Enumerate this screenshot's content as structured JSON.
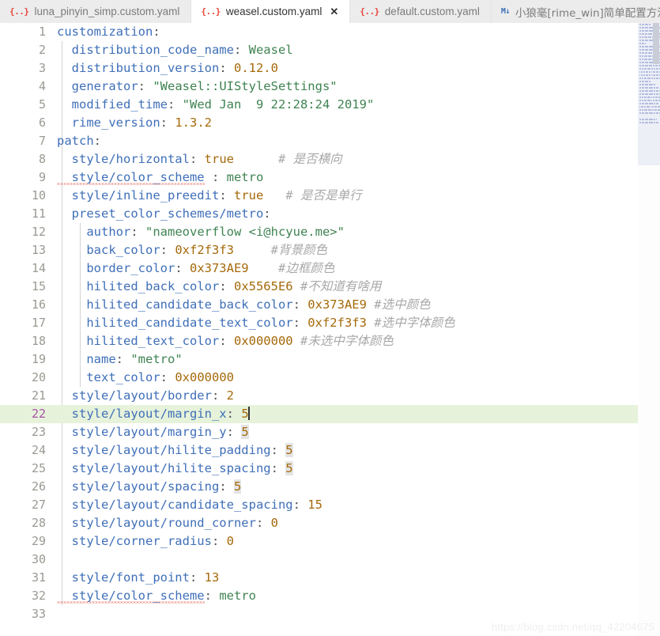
{
  "window": {
    "app": "Visual Studio Code",
    "active_file": "weasel.custom.yaml"
  },
  "tabs": [
    {
      "label": "luna_pinyin_simp.custom.yaml",
      "icon": "yaml-file-icon",
      "icon_glyph": "{..}",
      "active": false,
      "closable": false,
      "cjk": false
    },
    {
      "label": "weasel.custom.yaml",
      "icon": "yaml-file-icon",
      "icon_glyph": "{..}",
      "active": true,
      "closable": true,
      "close_glyph": "✕",
      "cjk": false
    },
    {
      "label": "default.custom.yaml",
      "icon": "yaml-file-icon",
      "icon_glyph": "{..}",
      "active": false,
      "closable": false,
      "cjk": false
    },
    {
      "label": "小狼毫[rime_win]简单配置方法.md",
      "icon": "markdown-file-icon",
      "icon_glyph": "M↓",
      "active": false,
      "closable": false,
      "cjk": true
    }
  ],
  "editor": {
    "cursor_line": 22,
    "total_visible_lines": 33,
    "colors": {
      "key": "#3f6fb8",
      "string": "#3f8352",
      "number": "#a5690a",
      "comment": "#a8a8a8",
      "current_line_bg": "#e6f2da",
      "current_line_number": "#a854a8",
      "line_number": "#9a9a93",
      "background": "#ffffff"
    },
    "lines": [
      {
        "n": 1,
        "indent": 0,
        "tokens": [
          {
            "t": "k",
            "v": "customization"
          },
          {
            "t": "p",
            "v": ":"
          }
        ]
      },
      {
        "n": 2,
        "indent": 1,
        "tokens": [
          {
            "t": "k",
            "v": "  distribution_code_name"
          },
          {
            "t": "p",
            "v": ": "
          },
          {
            "t": "s",
            "v": "Weasel"
          }
        ]
      },
      {
        "n": 3,
        "indent": 1,
        "tokens": [
          {
            "t": "k",
            "v": "  distribution_version"
          },
          {
            "t": "p",
            "v": ": "
          },
          {
            "t": "n",
            "v": "0.12.0"
          }
        ]
      },
      {
        "n": 4,
        "indent": 1,
        "tokens": [
          {
            "t": "k",
            "v": "  generator"
          },
          {
            "t": "p",
            "v": ": "
          },
          {
            "t": "s",
            "v": "\"Weasel::UIStyleSettings\""
          }
        ]
      },
      {
        "n": 5,
        "indent": 1,
        "tokens": [
          {
            "t": "k",
            "v": "  modified_time"
          },
          {
            "t": "p",
            "v": ": "
          },
          {
            "t": "s",
            "v": "\"Wed Jan  9 22:28:24 2019\""
          }
        ]
      },
      {
        "n": 6,
        "indent": 1,
        "tokens": [
          {
            "t": "k",
            "v": "  rime_version"
          },
          {
            "t": "p",
            "v": ": "
          },
          {
            "t": "n",
            "v": "1.3.2"
          }
        ]
      },
      {
        "n": 7,
        "indent": 0,
        "tokens": [
          {
            "t": "k",
            "v": "patch"
          },
          {
            "t": "p",
            "v": ":"
          }
        ]
      },
      {
        "n": 8,
        "indent": 1,
        "tokens": [
          {
            "t": "k",
            "v": "  style/horizontal"
          },
          {
            "t": "p",
            "v": ": "
          },
          {
            "t": "n",
            "v": "true"
          },
          {
            "t": "c",
            "v": "      # "
          },
          {
            "t": "c-cjk",
            "v": "是否横向"
          }
        ]
      },
      {
        "n": 9,
        "indent": 1,
        "tokens": [
          {
            "t": "k squig",
            "v": "  style/color_scheme"
          },
          {
            "t": "p",
            "v": " : "
          },
          {
            "t": "s",
            "v": "metro"
          }
        ]
      },
      {
        "n": 10,
        "indent": 1,
        "tokens": [
          {
            "t": "k",
            "v": "  style/inline_preedit"
          },
          {
            "t": "p",
            "v": ": "
          },
          {
            "t": "n",
            "v": "true"
          },
          {
            "t": "c",
            "v": "   # "
          },
          {
            "t": "c-cjk",
            "v": "是否是单行"
          }
        ]
      },
      {
        "n": 11,
        "indent": 1,
        "tokens": [
          {
            "t": "k",
            "v": "  preset_color_schemes/metro"
          },
          {
            "t": "p",
            "v": ":"
          }
        ]
      },
      {
        "n": 12,
        "indent": 2,
        "tokens": [
          {
            "t": "k",
            "v": "    author"
          },
          {
            "t": "p",
            "v": ": "
          },
          {
            "t": "s",
            "v": "\"nameoverflow <i@hcyue.me>\""
          }
        ]
      },
      {
        "n": 13,
        "indent": 2,
        "tokens": [
          {
            "t": "k",
            "v": "    back_color"
          },
          {
            "t": "p",
            "v": ": "
          },
          {
            "t": "n",
            "v": "0xf2f3f3"
          },
          {
            "t": "c",
            "v": "     #"
          },
          {
            "t": "c-cjk",
            "v": "背景颜色"
          }
        ]
      },
      {
        "n": 14,
        "indent": 2,
        "tokens": [
          {
            "t": "k",
            "v": "    border_color"
          },
          {
            "t": "p",
            "v": ": "
          },
          {
            "t": "n",
            "v": "0x373AE9"
          },
          {
            "t": "c",
            "v": "    #"
          },
          {
            "t": "c-cjk",
            "v": "边框颜色"
          }
        ]
      },
      {
        "n": 15,
        "indent": 2,
        "tokens": [
          {
            "t": "k",
            "v": "    hilited_back_color"
          },
          {
            "t": "p",
            "v": ": "
          },
          {
            "t": "n",
            "v": "0x5565E6"
          },
          {
            "t": "c",
            "v": " #"
          },
          {
            "t": "c-cjk",
            "v": "不知道有啥用"
          }
        ]
      },
      {
        "n": 16,
        "indent": 2,
        "tokens": [
          {
            "t": "k",
            "v": "    hilited_candidate_back_color"
          },
          {
            "t": "p",
            "v": ": "
          },
          {
            "t": "n",
            "v": "0x373AE9"
          },
          {
            "t": "c",
            "v": " #"
          },
          {
            "t": "c-cjk",
            "v": "选中颜色"
          }
        ]
      },
      {
        "n": 17,
        "indent": 2,
        "tokens": [
          {
            "t": "k",
            "v": "    hilited_candidate_text_color"
          },
          {
            "t": "p",
            "v": ": "
          },
          {
            "t": "n",
            "v": "0xf2f3f3"
          },
          {
            "t": "c",
            "v": " #"
          },
          {
            "t": "c-cjk",
            "v": "选中字体颜色"
          }
        ]
      },
      {
        "n": 18,
        "indent": 2,
        "tokens": [
          {
            "t": "k",
            "v": "    hilited_text_color"
          },
          {
            "t": "p",
            "v": ": "
          },
          {
            "t": "n",
            "v": "0x000000"
          },
          {
            "t": "c",
            "v": " #"
          },
          {
            "t": "c-cjk",
            "v": "未选中字体颜色"
          }
        ]
      },
      {
        "n": 19,
        "indent": 2,
        "tokens": [
          {
            "t": "k",
            "v": "    name"
          },
          {
            "t": "p",
            "v": ": "
          },
          {
            "t": "s",
            "v": "\"metro\""
          }
        ]
      },
      {
        "n": 20,
        "indent": 2,
        "tokens": [
          {
            "t": "k",
            "v": "    text_color"
          },
          {
            "t": "p",
            "v": ": "
          },
          {
            "t": "n",
            "v": "0x000000"
          }
        ]
      },
      {
        "n": 21,
        "indent": 1,
        "tokens": [
          {
            "t": "k",
            "v": "  style/layout/border"
          },
          {
            "t": "p",
            "v": ": "
          },
          {
            "t": "n",
            "v": "2"
          }
        ]
      },
      {
        "n": 22,
        "indent": 1,
        "current": true,
        "tokens": [
          {
            "t": "k",
            "v": "  style/layout/margin_x"
          },
          {
            "t": "p",
            "v": ": "
          },
          {
            "t": "n",
            "v": "5"
          },
          {
            "t": "caret",
            "v": ""
          }
        ]
      },
      {
        "n": 23,
        "indent": 1,
        "tokens": [
          {
            "t": "k",
            "v": "  style/layout/margin_y"
          },
          {
            "t": "p",
            "v": ": "
          },
          {
            "t": "n occ",
            "v": "5"
          }
        ]
      },
      {
        "n": 24,
        "indent": 1,
        "tokens": [
          {
            "t": "k",
            "v": "  style/layout/hilite_padding"
          },
          {
            "t": "p",
            "v": ": "
          },
          {
            "t": "n occ",
            "v": "5"
          }
        ]
      },
      {
        "n": 25,
        "indent": 1,
        "tokens": [
          {
            "t": "k",
            "v": "  style/layout/hilite_spacing"
          },
          {
            "t": "p",
            "v": ": "
          },
          {
            "t": "n occ",
            "v": "5"
          }
        ]
      },
      {
        "n": 26,
        "indent": 1,
        "tokens": [
          {
            "t": "k",
            "v": "  style/layout/spacing"
          },
          {
            "t": "p",
            "v": ": "
          },
          {
            "t": "n occ",
            "v": "5"
          }
        ]
      },
      {
        "n": 27,
        "indent": 1,
        "tokens": [
          {
            "t": "k",
            "v": "  style/layout/candidate_spacing"
          },
          {
            "t": "p",
            "v": ": "
          },
          {
            "t": "n",
            "v": "15"
          }
        ]
      },
      {
        "n": 28,
        "indent": 1,
        "tokens": [
          {
            "t": "k",
            "v": "  style/layout/round_corner"
          },
          {
            "t": "p",
            "v": ": "
          },
          {
            "t": "n",
            "v": "0"
          }
        ]
      },
      {
        "n": 29,
        "indent": 1,
        "tokens": [
          {
            "t": "k",
            "v": "  style/corner_radius"
          },
          {
            "t": "p",
            "v": ": "
          },
          {
            "t": "n",
            "v": "0"
          }
        ]
      },
      {
        "n": 30,
        "indent": 1,
        "tokens": []
      },
      {
        "n": 31,
        "indent": 1,
        "tokens": [
          {
            "t": "k",
            "v": "  style/font_point"
          },
          {
            "t": "p",
            "v": ": "
          },
          {
            "t": "n",
            "v": "13"
          }
        ]
      },
      {
        "n": 32,
        "indent": 1,
        "tokens": [
          {
            "t": "k squig",
            "v": "  style/color_scheme"
          },
          {
            "t": "p",
            "v": ": "
          },
          {
            "t": "s",
            "v": "metro"
          }
        ]
      },
      {
        "n": 33,
        "indent": 0,
        "tokens": []
      }
    ]
  },
  "minimap": {
    "visible": true,
    "line_widths": [
      14,
      26,
      24,
      28,
      30,
      22,
      8,
      26,
      24,
      28,
      30,
      30,
      26,
      27,
      31,
      38,
      38,
      31,
      14,
      20,
      24,
      26,
      26,
      32,
      32,
      24,
      34,
      30,
      26,
      0,
      22,
      24,
      0
    ]
  },
  "watermark": {
    "text": "https://blog.csdn.net/qq_42204675"
  }
}
